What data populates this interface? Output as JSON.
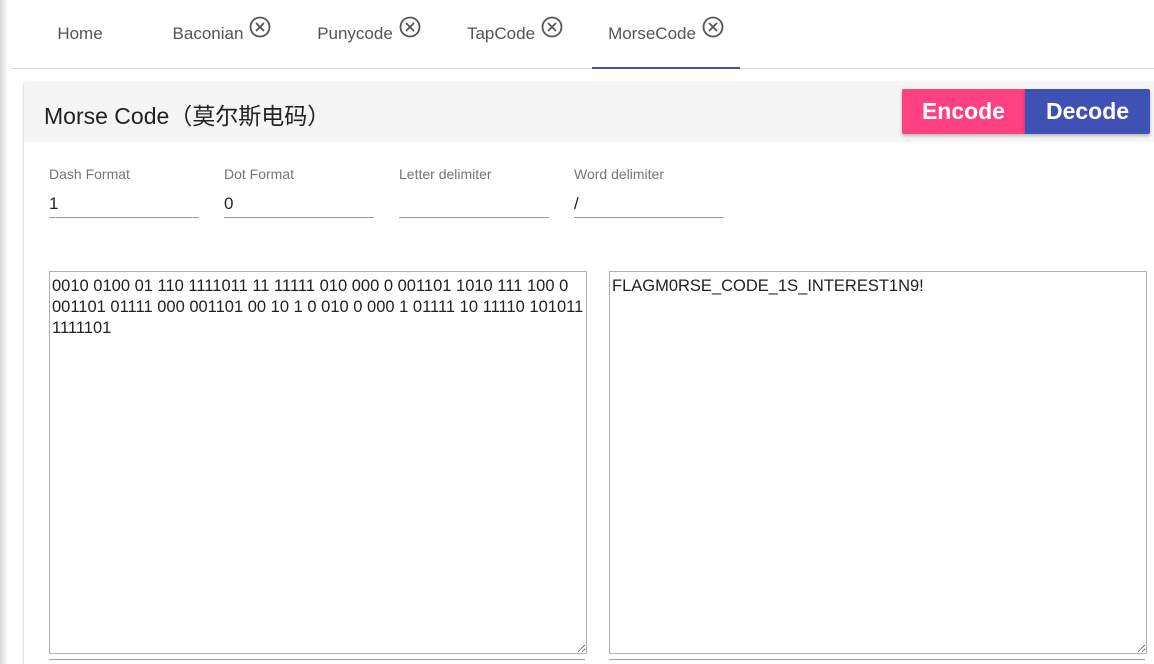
{
  "tabs": [
    {
      "label": "Home",
      "closable": false,
      "active": false
    },
    {
      "label": "Baconian",
      "closable": true,
      "active": false
    },
    {
      "label": "Punycode",
      "closable": true,
      "active": false
    },
    {
      "label": "TapCode",
      "closable": true,
      "active": false
    },
    {
      "label": "MorseCode",
      "closable": true,
      "active": true
    }
  ],
  "card": {
    "title": "Morse Code（莫尔斯电码）",
    "encode_label": "Encode",
    "decode_label": "Decode"
  },
  "options": {
    "dash_format": {
      "label": "Dash Format",
      "value": "1"
    },
    "dot_format": {
      "label": "Dot Format",
      "value": "0"
    },
    "letter_delimiter": {
      "label": "Letter delimiter",
      "value": ""
    },
    "word_delimiter": {
      "label": "Word delimiter",
      "value": "/"
    }
  },
  "input_text": "0010 0100 01 110 1111011 11 11111 010 000 0 001101 1010 111 100 0 001101 01111 000 001101 00 10 1 0 010 0 000 1 01111 10 11110 101011 1111101",
  "output_text": "FLAGM0RSE_CODE_1S_INTEREST1N9!",
  "colors": {
    "encode": "#ff4081",
    "decode": "#3f51b5",
    "active_tab_indicator": "#3f51b5",
    "header_bg": "#f5f5f5"
  },
  "icons": {
    "tab_close": "close-circle-icon"
  }
}
